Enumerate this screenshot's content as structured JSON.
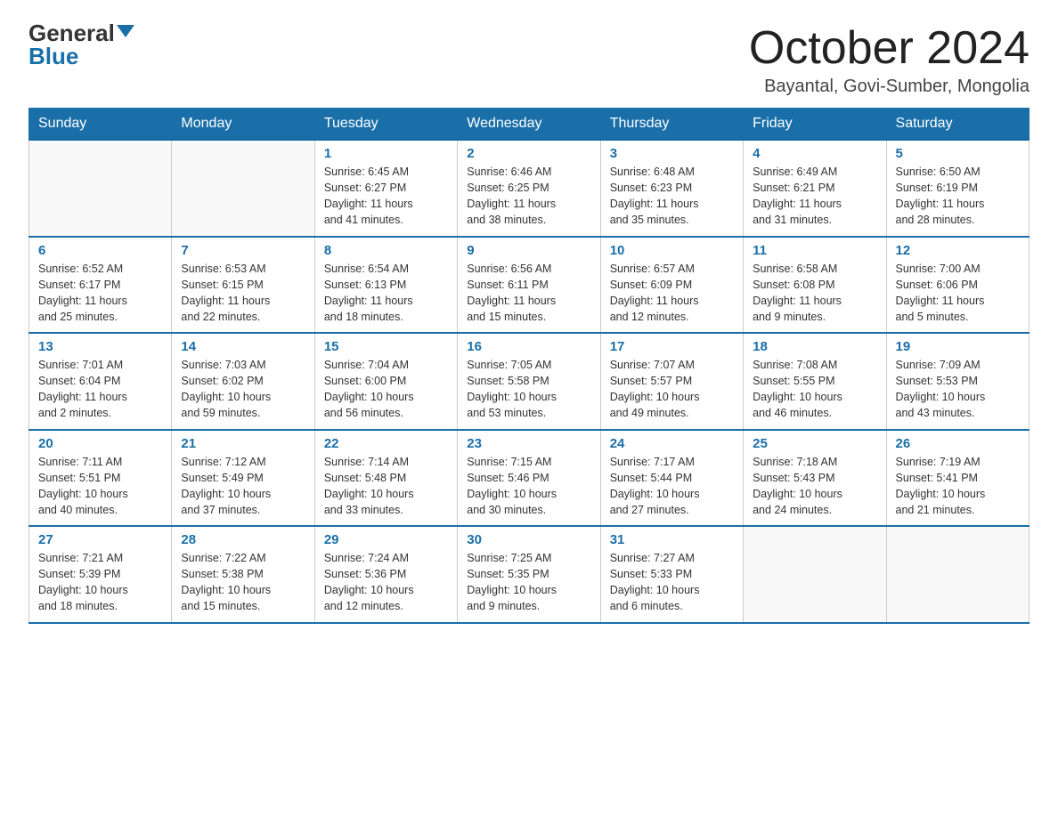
{
  "logo": {
    "general": "General",
    "blue": "Blue"
  },
  "title": {
    "month": "October 2024",
    "location": "Bayantal, Govi-Sumber, Mongolia"
  },
  "weekdays": [
    "Sunday",
    "Monday",
    "Tuesday",
    "Wednesday",
    "Thursday",
    "Friday",
    "Saturday"
  ],
  "weeks": [
    [
      {
        "day": "",
        "info": ""
      },
      {
        "day": "",
        "info": ""
      },
      {
        "day": "1",
        "info": "Sunrise: 6:45 AM\nSunset: 6:27 PM\nDaylight: 11 hours\nand 41 minutes."
      },
      {
        "day": "2",
        "info": "Sunrise: 6:46 AM\nSunset: 6:25 PM\nDaylight: 11 hours\nand 38 minutes."
      },
      {
        "day": "3",
        "info": "Sunrise: 6:48 AM\nSunset: 6:23 PM\nDaylight: 11 hours\nand 35 minutes."
      },
      {
        "day": "4",
        "info": "Sunrise: 6:49 AM\nSunset: 6:21 PM\nDaylight: 11 hours\nand 31 minutes."
      },
      {
        "day": "5",
        "info": "Sunrise: 6:50 AM\nSunset: 6:19 PM\nDaylight: 11 hours\nand 28 minutes."
      }
    ],
    [
      {
        "day": "6",
        "info": "Sunrise: 6:52 AM\nSunset: 6:17 PM\nDaylight: 11 hours\nand 25 minutes."
      },
      {
        "day": "7",
        "info": "Sunrise: 6:53 AM\nSunset: 6:15 PM\nDaylight: 11 hours\nand 22 minutes."
      },
      {
        "day": "8",
        "info": "Sunrise: 6:54 AM\nSunset: 6:13 PM\nDaylight: 11 hours\nand 18 minutes."
      },
      {
        "day": "9",
        "info": "Sunrise: 6:56 AM\nSunset: 6:11 PM\nDaylight: 11 hours\nand 15 minutes."
      },
      {
        "day": "10",
        "info": "Sunrise: 6:57 AM\nSunset: 6:09 PM\nDaylight: 11 hours\nand 12 minutes."
      },
      {
        "day": "11",
        "info": "Sunrise: 6:58 AM\nSunset: 6:08 PM\nDaylight: 11 hours\nand 9 minutes."
      },
      {
        "day": "12",
        "info": "Sunrise: 7:00 AM\nSunset: 6:06 PM\nDaylight: 11 hours\nand 5 minutes."
      }
    ],
    [
      {
        "day": "13",
        "info": "Sunrise: 7:01 AM\nSunset: 6:04 PM\nDaylight: 11 hours\nand 2 minutes."
      },
      {
        "day": "14",
        "info": "Sunrise: 7:03 AM\nSunset: 6:02 PM\nDaylight: 10 hours\nand 59 minutes."
      },
      {
        "day": "15",
        "info": "Sunrise: 7:04 AM\nSunset: 6:00 PM\nDaylight: 10 hours\nand 56 minutes."
      },
      {
        "day": "16",
        "info": "Sunrise: 7:05 AM\nSunset: 5:58 PM\nDaylight: 10 hours\nand 53 minutes."
      },
      {
        "day": "17",
        "info": "Sunrise: 7:07 AM\nSunset: 5:57 PM\nDaylight: 10 hours\nand 49 minutes."
      },
      {
        "day": "18",
        "info": "Sunrise: 7:08 AM\nSunset: 5:55 PM\nDaylight: 10 hours\nand 46 minutes."
      },
      {
        "day": "19",
        "info": "Sunrise: 7:09 AM\nSunset: 5:53 PM\nDaylight: 10 hours\nand 43 minutes."
      }
    ],
    [
      {
        "day": "20",
        "info": "Sunrise: 7:11 AM\nSunset: 5:51 PM\nDaylight: 10 hours\nand 40 minutes."
      },
      {
        "day": "21",
        "info": "Sunrise: 7:12 AM\nSunset: 5:49 PM\nDaylight: 10 hours\nand 37 minutes."
      },
      {
        "day": "22",
        "info": "Sunrise: 7:14 AM\nSunset: 5:48 PM\nDaylight: 10 hours\nand 33 minutes."
      },
      {
        "day": "23",
        "info": "Sunrise: 7:15 AM\nSunset: 5:46 PM\nDaylight: 10 hours\nand 30 minutes."
      },
      {
        "day": "24",
        "info": "Sunrise: 7:17 AM\nSunset: 5:44 PM\nDaylight: 10 hours\nand 27 minutes."
      },
      {
        "day": "25",
        "info": "Sunrise: 7:18 AM\nSunset: 5:43 PM\nDaylight: 10 hours\nand 24 minutes."
      },
      {
        "day": "26",
        "info": "Sunrise: 7:19 AM\nSunset: 5:41 PM\nDaylight: 10 hours\nand 21 minutes."
      }
    ],
    [
      {
        "day": "27",
        "info": "Sunrise: 7:21 AM\nSunset: 5:39 PM\nDaylight: 10 hours\nand 18 minutes."
      },
      {
        "day": "28",
        "info": "Sunrise: 7:22 AM\nSunset: 5:38 PM\nDaylight: 10 hours\nand 15 minutes."
      },
      {
        "day": "29",
        "info": "Sunrise: 7:24 AM\nSunset: 5:36 PM\nDaylight: 10 hours\nand 12 minutes."
      },
      {
        "day": "30",
        "info": "Sunrise: 7:25 AM\nSunset: 5:35 PM\nDaylight: 10 hours\nand 9 minutes."
      },
      {
        "day": "31",
        "info": "Sunrise: 7:27 AM\nSunset: 5:33 PM\nDaylight: 10 hours\nand 6 minutes."
      },
      {
        "day": "",
        "info": ""
      },
      {
        "day": "",
        "info": ""
      }
    ]
  ]
}
